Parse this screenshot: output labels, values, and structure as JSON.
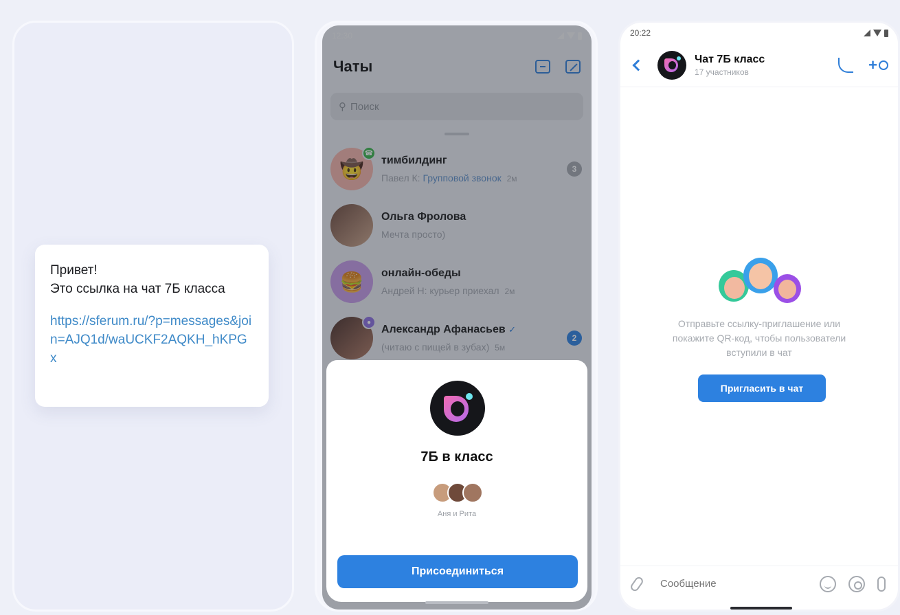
{
  "panel1": {
    "message_text": "Привет!\nЭто ссылка на чат 7Б класса",
    "message_link": "https://sferum.ru/?p=messages&join=AJQ1d/waUCKF2AQKH_hKPGx"
  },
  "panel2": {
    "status_time": "12:30",
    "title": "Чаты",
    "search_placeholder": "Поиск",
    "chats": [
      {
        "name": "тимбилдинг",
        "sender": "Павел К:",
        "preview": "Групповой звонок",
        "time": "2м",
        "badge": "3"
      },
      {
        "name": "Ольга Фролова",
        "preview": "Мечта просто)"
      },
      {
        "name": "онлайн-обеды",
        "sender": "Андрей Н:",
        "preview": "курьер приехал",
        "time": "2м"
      },
      {
        "name": "Александр Афанасьев",
        "preview": "(читаю с пищей в зубах)",
        "time": "5м",
        "badge": "2"
      }
    ],
    "sheet": {
      "chat_title": "7Б в класс",
      "members_caption": "Аня и Рита",
      "join_button": "Присоединиться"
    }
  },
  "panel3": {
    "status_time": "20:22",
    "chat_title": "Чат 7Б класс",
    "chat_subtitle": "17 участников",
    "empty_text": "Отправьте ссылку-приглашение или покажите QR-код, чтобы пользователи вступили в чат",
    "invite_button": "Пригласить в чат",
    "composer_placeholder": "Сообщение"
  },
  "colors": {
    "accent": "#2d81e0",
    "link": "#3f8ac8",
    "background": "#eef0f8"
  }
}
